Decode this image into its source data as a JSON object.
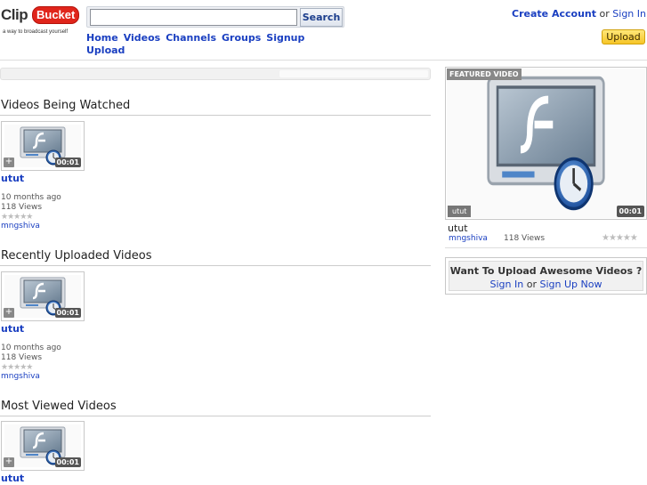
{
  "logo": {
    "clip": "Clip",
    "bucket": "Bucket",
    "tagline": "a way to broadcast yourself"
  },
  "search": {
    "value": "",
    "placeholder": "",
    "button": "Search"
  },
  "nav": {
    "items": [
      "Home",
      "Videos",
      "Channels",
      "Groups",
      "Signup",
      "Upload"
    ]
  },
  "account": {
    "create": "Create Account",
    "or": "or",
    "signin": "Sign In",
    "upload": "Upload"
  },
  "sections": [
    {
      "title": "Videos Being Watched",
      "video": {
        "title": "utut",
        "duration": "00:01",
        "age": "10 months ago",
        "views": "118 Views",
        "user": "mngshiva",
        "rating": "★★★★★"
      }
    },
    {
      "title": "Recently Uploaded Videos",
      "video": {
        "title": "utut",
        "duration": "00:01",
        "age": "10 months ago",
        "views": "118 Views",
        "user": "mngshiva",
        "rating": "★★★★★"
      }
    },
    {
      "title": "Most Viewed Videos",
      "video": {
        "title": "utut",
        "duration": "00:01"
      }
    }
  ],
  "featured": {
    "label": "FEATURED VIDEO",
    "badge": "utut",
    "duration": "00:01",
    "title": "utut",
    "user": "mngshiva",
    "views": "118 Views",
    "rating": "★★★★★"
  },
  "promo": {
    "question": "Want To Upload Awesome Videos ?",
    "signin": "Sign In",
    "or": "or",
    "signup": "Sign Up Now"
  },
  "icons": {
    "thumb": "flash-video-clock-icon",
    "plus": "plus-icon"
  }
}
